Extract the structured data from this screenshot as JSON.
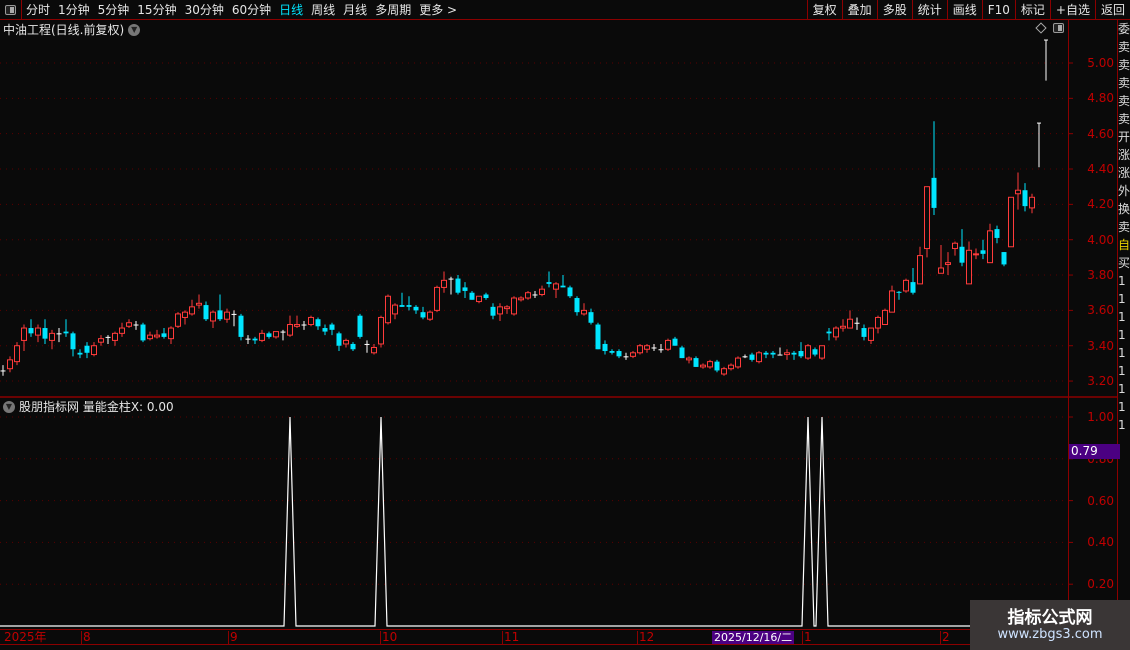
{
  "toolbar": {
    "periods": [
      "分时",
      "1分钟",
      "5分钟",
      "15分钟",
      "30分钟",
      "60分钟",
      "日线",
      "周线",
      "月线",
      "多周期",
      "更多 >"
    ],
    "active_period": "日线",
    "buttons": [
      "复权",
      "叠加",
      "多股",
      "统计",
      "画线",
      "F10",
      "标记",
      "+自选",
      "返回"
    ]
  },
  "main": {
    "title": "中油工程(日线.前复权)",
    "price_ticks": [
      "5.00",
      "4.80",
      "4.60",
      "4.40",
      "4.20",
      "4.00",
      "3.80",
      "3.60",
      "3.40",
      "3.20"
    ]
  },
  "indicator": {
    "title": "股朋指标网 量能金柱X: 0.00",
    "ticks": [
      "1.00",
      "0.80",
      "0.60",
      "0.40",
      "0.20"
    ],
    "current_value": "0.79"
  },
  "date_axis": {
    "labels": [
      "2025年",
      "8",
      "9",
      "10",
      "11",
      "12",
      "1",
      "2"
    ],
    "cursor_date": "2025/12/16/二"
  },
  "right_strip": [
    "委",
    "卖",
    "卖",
    "卖",
    "卖",
    "卖",
    "开",
    "涨",
    "涨",
    "外",
    "换",
    "卖",
    "自",
    "买",
    "1",
    "1",
    "1",
    "1",
    "1",
    "1",
    "1",
    "1",
    "1"
  ],
  "watermark": {
    "line1": "指标公式网",
    "line2": "www.zbgs3.com"
  },
  "colors": {
    "up": "#ff3b3b",
    "down": "#00e5ff",
    "doji": "#ffffff",
    "axis": "#c00000",
    "border": "#8b0000",
    "highlight": "#4b0082"
  },
  "chart_data": {
    "type": "candlestick",
    "ylim": [
      3.15,
      5.2
    ],
    "candles_ohlc": [
      [
        3.26,
        3.29,
        3.23,
        3.26
      ],
      [
        3.27,
        3.34,
        3.25,
        3.32
      ],
      [
        3.31,
        3.42,
        3.29,
        3.4
      ],
      [
        3.43,
        3.52,
        3.37,
        3.5
      ],
      [
        3.5,
        3.55,
        3.45,
        3.47
      ],
      [
        3.46,
        3.52,
        3.42,
        3.5
      ],
      [
        3.5,
        3.55,
        3.41,
        3.44
      ],
      [
        3.43,
        3.49,
        3.38,
        3.47
      ],
      [
        3.47,
        3.5,
        3.42,
        3.47
      ],
      [
        3.48,
        3.55,
        3.45,
        3.47
      ],
      [
        3.47,
        3.48,
        3.34,
        3.38
      ],
      [
        3.36,
        3.38,
        3.33,
        3.35
      ],
      [
        3.4,
        3.42,
        3.33,
        3.36
      ],
      [
        3.35,
        3.42,
        3.34,
        3.4
      ],
      [
        3.42,
        3.46,
        3.4,
        3.44
      ],
      [
        3.45,
        3.46,
        3.41,
        3.45
      ],
      [
        3.43,
        3.48,
        3.4,
        3.47
      ],
      [
        3.47,
        3.53,
        3.45,
        3.5
      ],
      [
        3.51,
        3.55,
        3.5,
        3.53
      ],
      [
        3.52,
        3.54,
        3.49,
        3.52
      ],
      [
        3.52,
        3.53,
        3.42,
        3.43
      ],
      [
        3.44,
        3.48,
        3.43,
        3.46
      ],
      [
        3.45,
        3.49,
        3.44,
        3.46
      ],
      [
        3.47,
        3.5,
        3.44,
        3.45
      ],
      [
        3.44,
        3.51,
        3.41,
        3.5
      ],
      [
        3.51,
        3.59,
        3.5,
        3.58
      ],
      [
        3.56,
        3.6,
        3.52,
        3.59
      ],
      [
        3.58,
        3.66,
        3.57,
        3.62
      ],
      [
        3.63,
        3.69,
        3.61,
        3.64
      ],
      [
        3.63,
        3.65,
        3.54,
        3.55
      ],
      [
        3.54,
        3.6,
        3.5,
        3.59
      ],
      [
        3.6,
        3.69,
        3.54,
        3.55
      ],
      [
        3.55,
        3.61,
        3.53,
        3.59
      ],
      [
        3.58,
        3.6,
        3.51,
        3.58
      ],
      [
        3.57,
        3.58,
        3.43,
        3.45
      ],
      [
        3.44,
        3.46,
        3.41,
        3.44
      ],
      [
        3.44,
        3.45,
        3.41,
        3.43
      ],
      [
        3.43,
        3.49,
        3.42,
        3.47
      ],
      [
        3.47,
        3.48,
        3.44,
        3.45
      ],
      [
        3.45,
        3.48,
        3.44,
        3.48
      ],
      [
        3.48,
        3.49,
        3.43,
        3.48
      ],
      [
        3.46,
        3.57,
        3.45,
        3.52
      ],
      [
        3.51,
        3.57,
        3.5,
        3.52
      ],
      [
        3.52,
        3.54,
        3.49,
        3.52
      ],
      [
        3.52,
        3.57,
        3.51,
        3.56
      ],
      [
        3.55,
        3.56,
        3.49,
        3.51
      ],
      [
        3.5,
        3.52,
        3.46,
        3.48
      ],
      [
        3.52,
        3.53,
        3.46,
        3.49
      ],
      [
        3.47,
        3.48,
        3.37,
        3.4
      ],
      [
        3.41,
        3.44,
        3.39,
        3.43
      ],
      [
        3.41,
        3.42,
        3.37,
        3.38
      ],
      [
        3.57,
        3.58,
        3.44,
        3.45
      ],
      [
        3.41,
        3.43,
        3.36,
        3.41
      ],
      [
        3.36,
        3.41,
        3.35,
        3.39
      ],
      [
        3.41,
        3.57,
        3.39,
        3.56
      ],
      [
        3.53,
        3.69,
        3.52,
        3.68
      ],
      [
        3.58,
        3.64,
        3.55,
        3.63
      ],
      [
        3.63,
        3.7,
        3.62,
        3.62
      ],
      [
        3.63,
        3.68,
        3.6,
        3.62
      ],
      [
        3.62,
        3.63,
        3.58,
        3.6
      ],
      [
        3.59,
        3.62,
        3.55,
        3.56
      ],
      [
        3.55,
        3.6,
        3.54,
        3.59
      ],
      [
        3.6,
        3.74,
        3.59,
        3.73
      ],
      [
        3.73,
        3.82,
        3.7,
        3.77
      ],
      [
        3.78,
        3.79,
        3.69,
        3.78
      ],
      [
        3.78,
        3.8,
        3.69,
        3.7
      ],
      [
        3.73,
        3.76,
        3.67,
        3.71
      ],
      [
        3.7,
        3.71,
        3.66,
        3.66
      ],
      [
        3.65,
        3.68,
        3.64,
        3.68
      ],
      [
        3.69,
        3.7,
        3.66,
        3.67
      ],
      [
        3.62,
        3.64,
        3.55,
        3.57
      ],
      [
        3.58,
        3.64,
        3.54,
        3.62
      ],
      [
        3.61,
        3.63,
        3.58,
        3.62
      ],
      [
        3.58,
        3.68,
        3.57,
        3.67
      ],
      [
        3.66,
        3.68,
        3.65,
        3.67
      ],
      [
        3.67,
        3.71,
        3.66,
        3.7
      ],
      [
        3.69,
        3.71,
        3.67,
        3.69
      ],
      [
        3.69,
        3.74,
        3.68,
        3.72
      ],
      [
        3.76,
        3.82,
        3.73,
        3.75
      ],
      [
        3.72,
        3.76,
        3.67,
        3.75
      ],
      [
        3.74,
        3.8,
        3.73,
        3.73
      ],
      [
        3.73,
        3.74,
        3.67,
        3.68
      ],
      [
        3.67,
        3.68,
        3.57,
        3.59
      ],
      [
        3.58,
        3.64,
        3.57,
        3.6
      ],
      [
        3.59,
        3.61,
        3.52,
        3.53
      ],
      [
        3.52,
        3.53,
        3.38,
        3.38
      ],
      [
        3.41,
        3.43,
        3.35,
        3.37
      ],
      [
        3.37,
        3.38,
        3.35,
        3.36
      ],
      [
        3.37,
        3.38,
        3.33,
        3.34
      ],
      [
        3.34,
        3.36,
        3.32,
        3.34
      ],
      [
        3.34,
        3.37,
        3.33,
        3.36
      ],
      [
        3.36,
        3.41,
        3.35,
        3.4
      ],
      [
        3.38,
        3.41,
        3.36,
        3.4
      ],
      [
        3.39,
        3.41,
        3.37,
        3.39
      ],
      [
        3.38,
        3.41,
        3.36,
        3.38
      ],
      [
        3.38,
        3.44,
        3.37,
        3.43
      ],
      [
        3.44,
        3.45,
        3.4,
        3.4
      ],
      [
        3.39,
        3.4,
        3.33,
        3.33
      ],
      [
        3.32,
        3.34,
        3.3,
        3.33
      ],
      [
        3.33,
        3.34,
        3.28,
        3.28
      ],
      [
        3.28,
        3.3,
        3.27,
        3.29
      ],
      [
        3.28,
        3.32,
        3.27,
        3.31
      ],
      [
        3.31,
        3.32,
        3.25,
        3.26
      ],
      [
        3.24,
        3.28,
        3.23,
        3.27
      ],
      [
        3.27,
        3.3,
        3.26,
        3.29
      ],
      [
        3.28,
        3.34,
        3.27,
        3.33
      ],
      [
        3.34,
        3.35,
        3.33,
        3.34
      ],
      [
        3.35,
        3.36,
        3.31,
        3.32
      ],
      [
        3.31,
        3.37,
        3.3,
        3.36
      ],
      [
        3.36,
        3.37,
        3.33,
        3.35
      ],
      [
        3.36,
        3.37,
        3.33,
        3.35
      ],
      [
        3.35,
        3.39,
        3.35,
        3.35
      ],
      [
        3.35,
        3.38,
        3.32,
        3.36
      ],
      [
        3.36,
        3.37,
        3.32,
        3.35
      ],
      [
        3.37,
        3.42,
        3.33,
        3.34
      ],
      [
        3.33,
        3.41,
        3.32,
        3.4
      ],
      [
        3.38,
        3.39,
        3.34,
        3.35
      ],
      [
        3.33,
        3.4,
        3.32,
        3.4
      ],
      [
        3.48,
        3.5,
        3.43,
        3.47
      ],
      [
        3.45,
        3.51,
        3.43,
        3.5
      ],
      [
        3.5,
        3.55,
        3.48,
        3.51
      ],
      [
        3.5,
        3.6,
        3.5,
        3.55
      ],
      [
        3.53,
        3.56,
        3.49,
        3.53
      ],
      [
        3.5,
        3.52,
        3.43,
        3.45
      ],
      [
        3.43,
        3.5,
        3.41,
        3.5
      ],
      [
        3.5,
        3.57,
        3.47,
        3.56
      ],
      [
        3.52,
        3.61,
        3.52,
        3.6
      ],
      [
        3.59,
        3.74,
        3.59,
        3.71
      ],
      [
        3.705,
        3.71,
        3.66,
        3.7
      ],
      [
        3.71,
        3.78,
        3.7,
        3.77
      ],
      [
        3.76,
        3.84,
        3.69,
        3.7
      ],
      [
        3.75,
        3.96,
        3.75,
        3.91
      ],
      [
        3.95,
        4.3,
        3.9,
        4.3
      ],
      [
        4.35,
        4.67,
        4.14,
        4.18
      ],
      [
        3.81,
        3.97,
        3.81,
        3.84
      ],
      [
        3.86,
        3.93,
        3.8,
        3.87
      ],
      [
        3.95,
        3.99,
        3.91,
        3.98
      ],
      [
        3.96,
        4.06,
        3.85,
        3.87
      ],
      [
        3.75,
        3.99,
        3.75,
        3.94
      ],
      [
        3.915,
        3.95,
        3.89,
        3.92
      ],
      [
        3.94,
        4.0,
        3.89,
        3.92
      ],
      [
        3.87,
        4.09,
        3.87,
        4.05
      ],
      [
        4.06,
        4.08,
        3.98,
        4.01
      ],
      [
        3.93,
        3.93,
        3.85,
        3.86
      ],
      [
        3.96,
        4.24,
        3.96,
        4.24
      ],
      [
        4.26,
        4.38,
        4.17,
        4.28
      ],
      [
        4.28,
        4.32,
        4.16,
        4.19
      ],
      [
        4.18,
        4.26,
        4.15,
        4.24
      ]
    ],
    "overlay_marks": [
      {
        "low": 4.41,
        "high": 4.66
      },
      {
        "low": 4.9,
        "high": 5.13
      }
    ],
    "indicator": {
      "name": "量能金柱X",
      "ylim": [
        0,
        1.05
      ],
      "values": [
        0,
        0,
        0,
        0,
        0,
        0,
        0,
        0,
        0,
        0,
        0,
        0,
        0,
        0,
        0,
        0,
        0,
        0,
        0,
        0,
        0,
        0,
        0,
        0,
        0,
        0,
        0,
        0,
        0,
        0,
        0,
        0,
        0,
        0,
        0,
        0,
        0,
        0,
        0,
        0,
        0,
        1,
        0,
        0,
        0,
        0,
        0,
        0,
        0,
        0,
        0,
        0,
        0,
        0,
        1,
        0,
        0,
        0,
        0,
        0,
        0,
        0,
        0,
        0,
        0,
        0,
        0,
        0,
        0,
        0,
        0,
        0,
        0,
        0,
        0,
        0,
        0,
        0,
        0,
        0,
        0,
        0,
        0,
        0,
        0,
        0,
        0,
        0,
        0,
        0,
        0,
        0,
        0,
        0,
        0,
        0,
        0,
        0,
        0,
        0,
        0,
        0,
        0,
        0,
        0,
        0,
        0,
        0,
        0,
        0,
        0,
        0,
        0,
        0,
        0,
        1,
        0,
        1,
        0,
        0,
        0,
        0,
        0,
        0,
        0,
        0,
        0,
        0,
        0,
        0,
        0,
        0,
        0,
        0,
        0,
        0,
        0,
        0,
        0,
        0,
        0,
        0,
        0,
        0,
        0,
        0,
        0,
        0
      ]
    }
  }
}
